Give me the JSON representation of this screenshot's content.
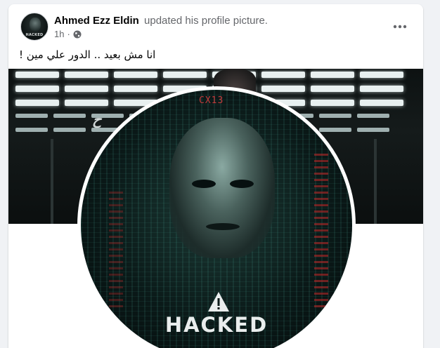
{
  "post": {
    "author": "Ahmed Ezz Eldin",
    "action": "updated his profile picture.",
    "time": "1h",
    "audience_icon": "globe-icon",
    "more_icon": "more-options-icon",
    "text": "انا مش بعيد .. الدور علي مين !"
  },
  "avatar": {
    "label": "HACKED"
  },
  "profile_picture": {
    "code_tag": "CX13",
    "overlay_icon": "warning-icon",
    "overlay_text": "HACKED"
  },
  "colors": {
    "name": "#050505",
    "secondary_text": "#65676b",
    "card_bg": "#ffffff",
    "page_bg": "#f0f2f5"
  }
}
